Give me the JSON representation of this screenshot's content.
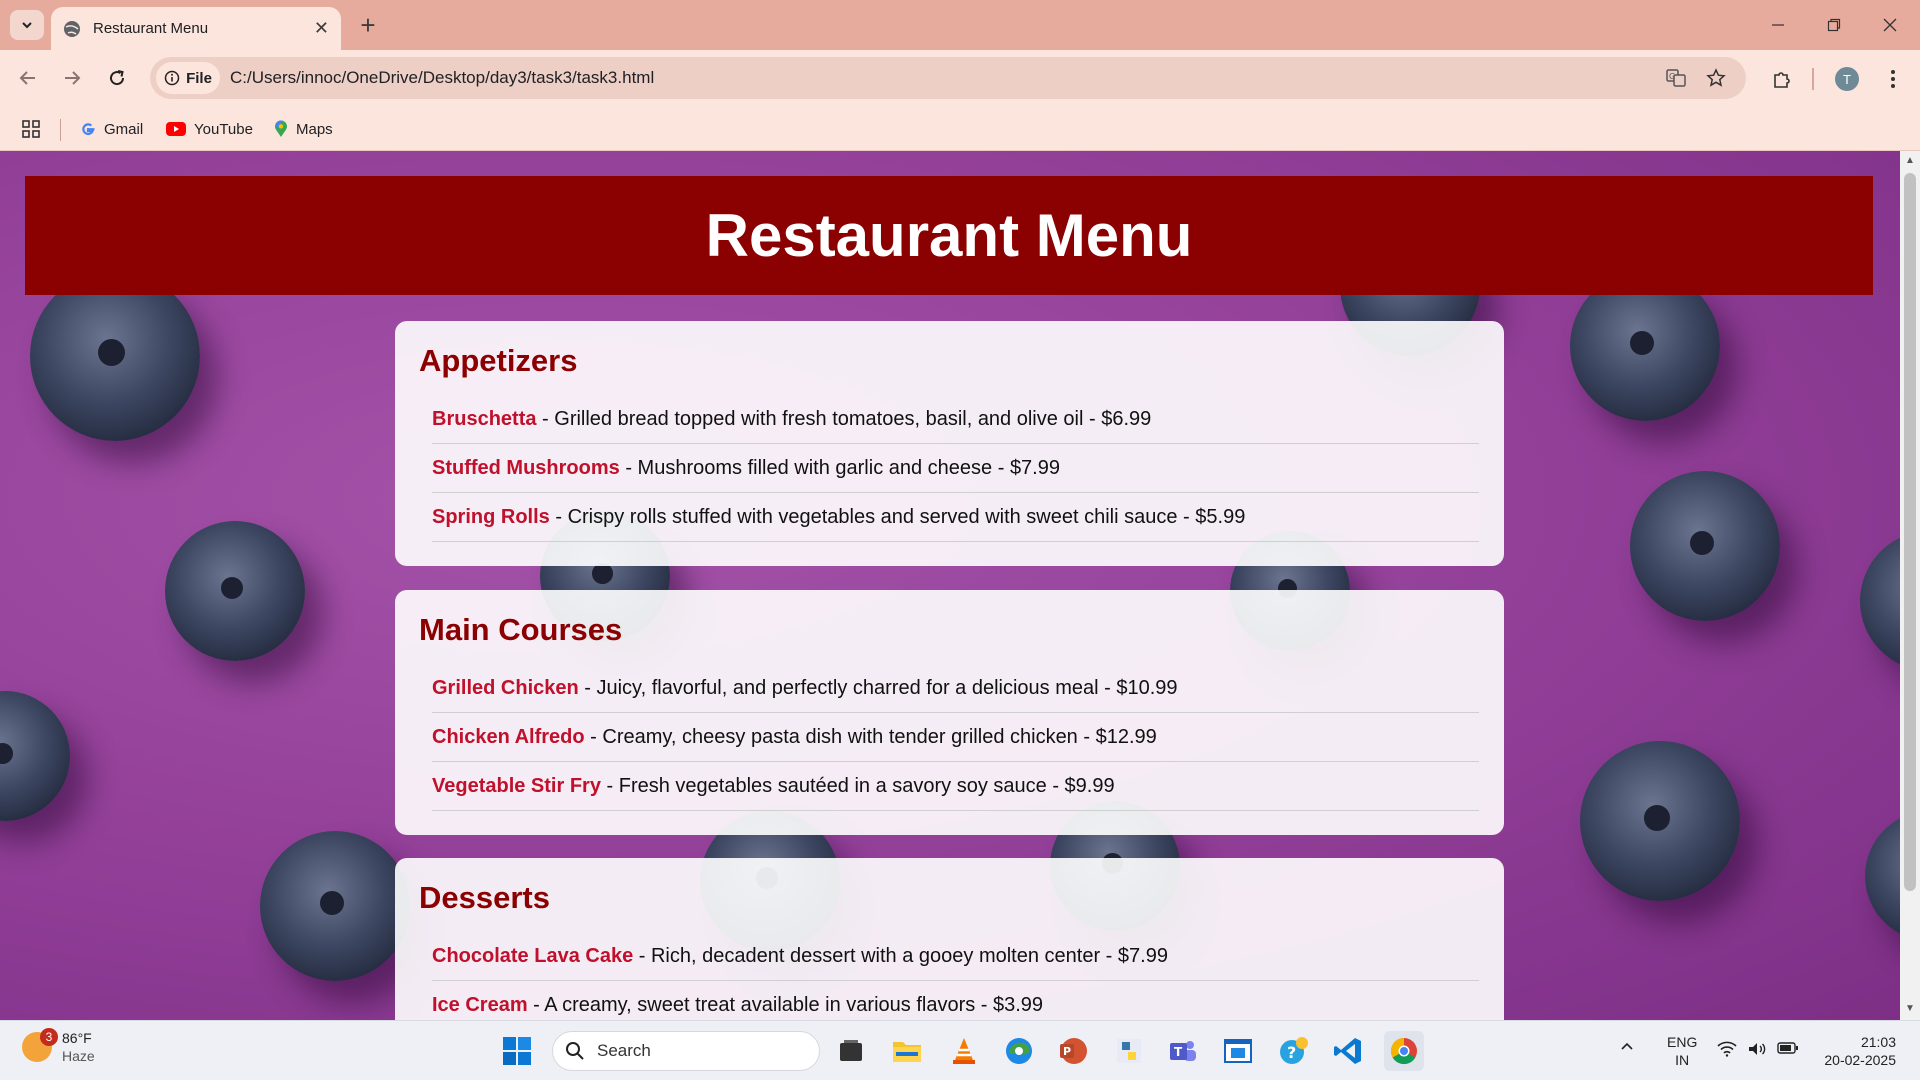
{
  "browser": {
    "tab_title": "Restaurant Menu",
    "url": "C:/Users/innoc/OneDrive/Desktop/day3/task3/task3.html",
    "url_chip": "File",
    "profile_initial": "T",
    "bookmarks": [
      {
        "label": "Gmail",
        "icon": "google-icon"
      },
      {
        "label": "YouTube",
        "icon": "youtube-icon"
      },
      {
        "label": "Maps",
        "icon": "maps-icon"
      }
    ]
  },
  "page": {
    "title": "Restaurant Menu",
    "sections": [
      {
        "heading": "Appetizers",
        "items": [
          {
            "name": "Bruschetta",
            "desc": " - Grilled bread topped with fresh tomatoes, basil, and olive oil - $6.99"
          },
          {
            "name": "Stuffed Mushrooms",
            "desc": " - Mushrooms filled with garlic and cheese - $7.99"
          },
          {
            "name": "Spring Rolls",
            "desc": " - Crispy rolls stuffed with vegetables and served with sweet chili sauce - $5.99"
          }
        ]
      },
      {
        "heading": "Main Courses",
        "items": [
          {
            "name": "Grilled Chicken",
            "desc": " - Juicy, flavorful, and perfectly charred for a delicious meal - $10.99"
          },
          {
            "name": "Chicken Alfredo",
            "desc": " - Creamy, cheesy pasta dish with tender grilled chicken - $12.99"
          },
          {
            "name": "Vegetable Stir Fry",
            "desc": " - Fresh vegetables sautéed in a savory soy sauce - $9.99"
          }
        ]
      },
      {
        "heading": "Desserts",
        "items": [
          {
            "name": "Chocolate Lava Cake",
            "desc": " - Rich, decadent dessert with a gooey molten center - $7.99"
          },
          {
            "name": "Ice Cream",
            "desc": " - A creamy, sweet treat available in various flavors - $3.99"
          }
        ]
      }
    ],
    "colors": {
      "header_bg": "#8b0000",
      "heading": "#8b0000",
      "item_name": "#c0102b",
      "background": "#934099"
    }
  },
  "taskbar": {
    "weather_temp": "86°F",
    "weather_cond": "Haze",
    "weather_badge": "3",
    "search_placeholder": "Search",
    "lang_top": "ENG",
    "lang_bottom": "IN",
    "time": "21:03",
    "date": "20-02-2025"
  }
}
